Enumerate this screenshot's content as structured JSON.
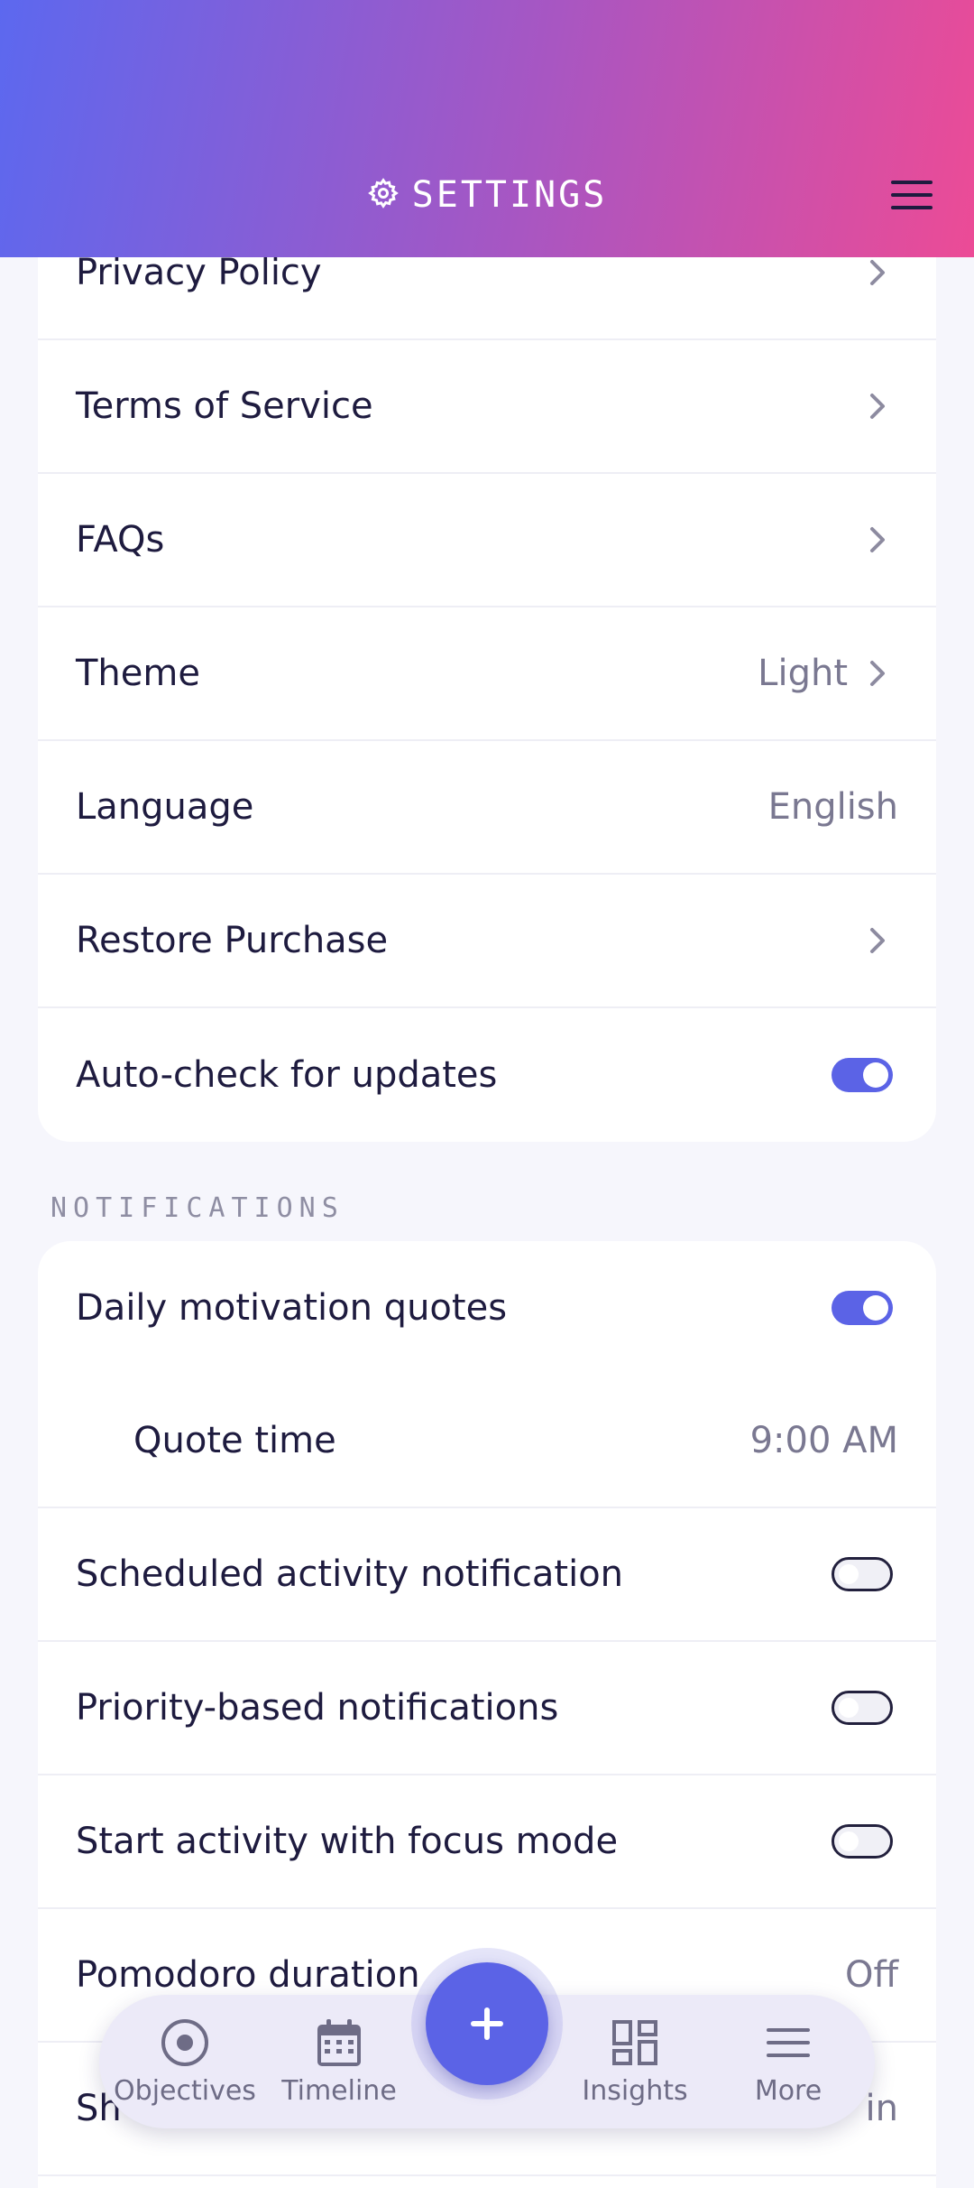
{
  "header": {
    "title": "SETTINGS"
  },
  "general": {
    "rows": [
      {
        "label": "Privacy Policy"
      },
      {
        "label": "Terms of Service"
      },
      {
        "label": "FAQs"
      },
      {
        "label": "Theme",
        "value": "Light"
      },
      {
        "label": "Language",
        "value": "English"
      },
      {
        "label": "Restore Purchase"
      },
      {
        "label": "Auto-check for updates",
        "toggle": "on"
      }
    ]
  },
  "notifications": {
    "section_title": "NOTIFICATIONS",
    "rows": [
      {
        "label": "Daily motivation quotes",
        "toggle": "on"
      },
      {
        "label": "Quote time",
        "value": "9:00 AM"
      },
      {
        "label": "Scheduled activity notification",
        "toggle": "off"
      },
      {
        "label": "Priority-based notifications",
        "toggle": "off"
      },
      {
        "label": "Start activity with focus mode",
        "toggle": "off"
      },
      {
        "label": "Pomodoro duration",
        "value": "Off"
      },
      {
        "label": "Sh",
        "value": "in"
      }
    ]
  },
  "bottom_nav": {
    "items": [
      {
        "label": "Objectives",
        "icon": "target-icon"
      },
      {
        "label": "Timeline",
        "icon": "calendar-icon"
      },
      {
        "label": "Insights",
        "icon": "dashboard-icon"
      },
      {
        "label": "More",
        "icon": "menu-icon"
      }
    ],
    "fab_icon": "plus-icon"
  },
  "colors": {
    "accent": "#5b63e6",
    "header_gradient_start": "#5c68ef",
    "header_gradient_end": "#ec4b96"
  }
}
